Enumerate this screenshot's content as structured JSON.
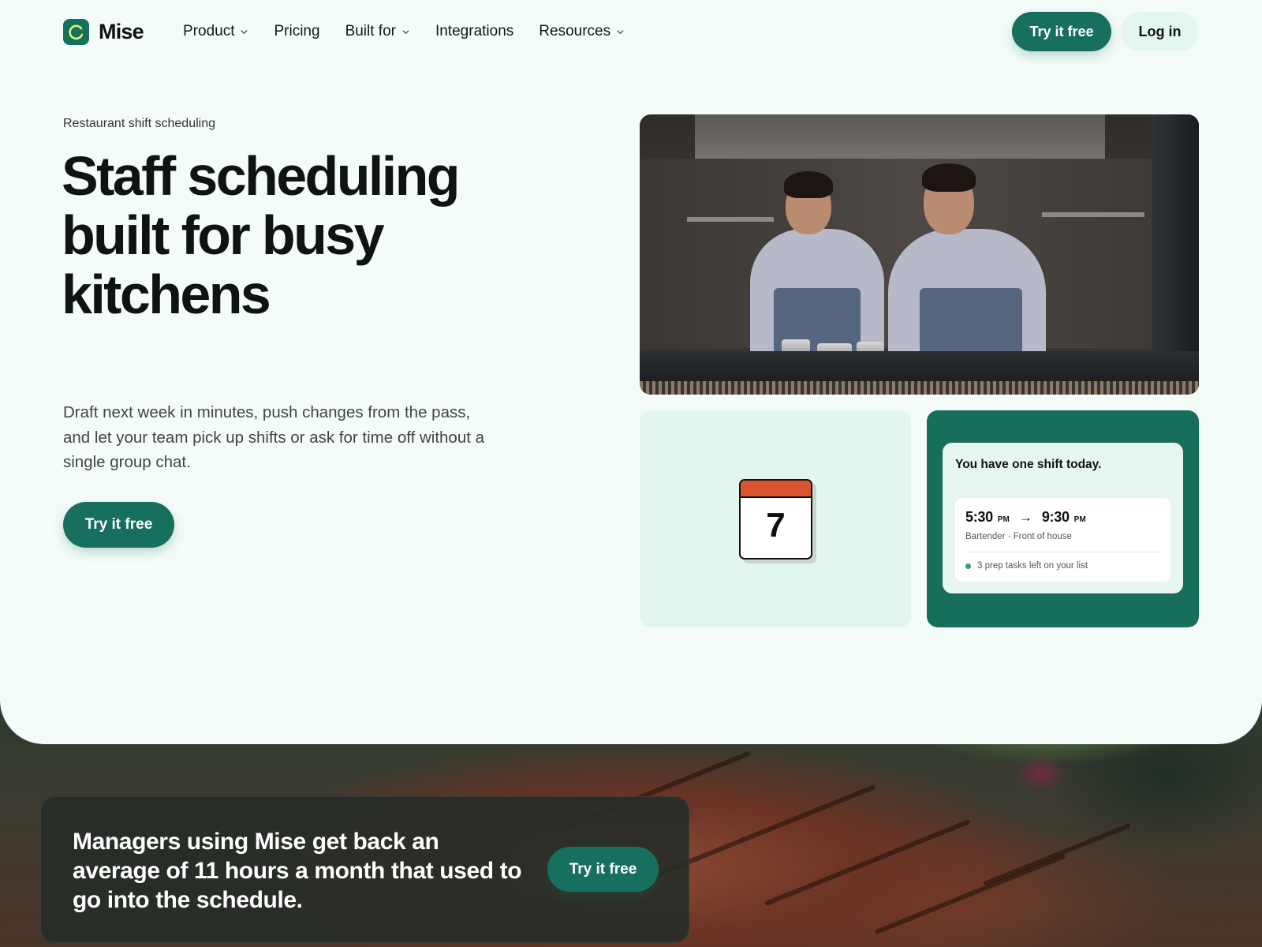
{
  "brand": {
    "name": "Mise"
  },
  "nav": {
    "items": [
      {
        "label": "Product",
        "has_dropdown": true
      },
      {
        "label": "Pricing",
        "has_dropdown": false
      },
      {
        "label": "Built for",
        "has_dropdown": true
      },
      {
        "label": "Integrations",
        "has_dropdown": false
      },
      {
        "label": "Resources",
        "has_dropdown": true
      }
    ],
    "cta_label": "Try it free",
    "login_label": "Log in"
  },
  "hero": {
    "eyebrow": "Restaurant shift scheduling",
    "headline": "Staff scheduling built for busy kitchens",
    "subcopy": "Draft next week in minutes, push changes from the pass, and let your team pick up shifts or ask for time off without a single group chat.",
    "cta_label": "Try it free"
  },
  "calendar_tile": {
    "day_number": "7"
  },
  "shift_tile": {
    "title": "You have one shift today.",
    "start_time": "5:30",
    "start_ampm": "PM",
    "end_time": "9:30",
    "end_ampm": "PM",
    "role": "Bartender · Front of house",
    "prep_note": "3 prep tasks left on your list"
  },
  "banner": {
    "text": "Managers using Mise get back an average of 11 hours a month that used to go into the schedule.",
    "cta_label": "Try it free"
  },
  "colors": {
    "brand_green": "#17705d",
    "page_bg": "#f4fcf9",
    "mint": "#e1f7ee",
    "calendar_red": "#d9532e"
  }
}
